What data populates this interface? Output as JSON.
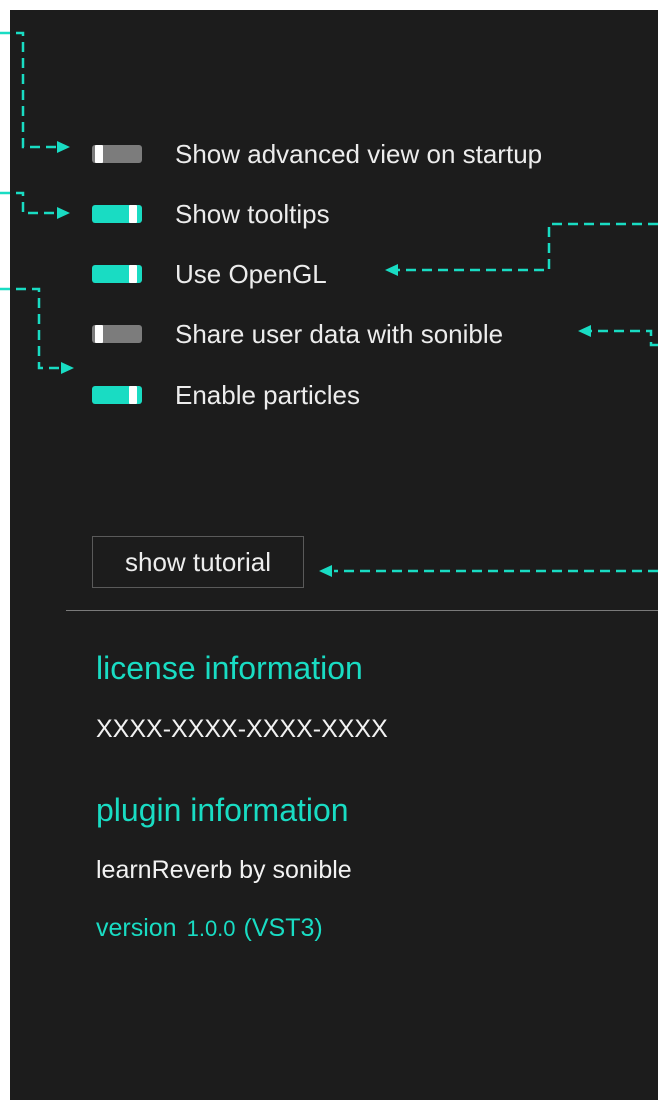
{
  "settings": [
    {
      "label": "Show advanced view on startup",
      "enabled": false
    },
    {
      "label": "Show tooltips",
      "enabled": true
    },
    {
      "label": "Use OpenGL",
      "enabled": true
    },
    {
      "label": "Share user data with sonible",
      "enabled": false
    },
    {
      "label": "Enable particles",
      "enabled": true
    }
  ],
  "tutorial_button": {
    "label": "show tutorial"
  },
  "license": {
    "heading": "license information",
    "key": "XXXX-XXXX-XXXX-XXXX"
  },
  "plugin": {
    "heading": "plugin information",
    "name": "learnReverb by sonible",
    "version_prefix": "version",
    "version_number": "1.0.0",
    "version_format": "(VST3)"
  },
  "colors": {
    "background": "#1c1c1c",
    "accent": "#19dcc3",
    "toggle_off": "#7c7c7c",
    "text": "#ececec"
  }
}
